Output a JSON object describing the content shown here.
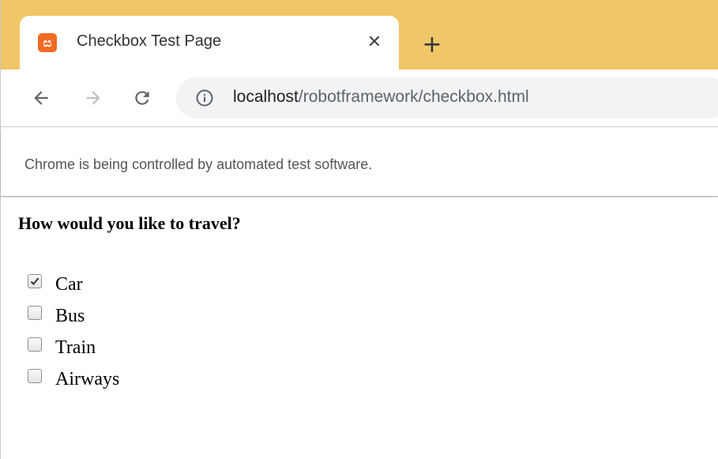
{
  "browser": {
    "tab": {
      "title": "Checkbox Test Page",
      "favicon_text": "ස",
      "close_glyph": "✕"
    },
    "new_tab_glyph": "+",
    "url": {
      "host": "localhost",
      "path": "/robotframework/checkbox.html"
    },
    "infobar_text": "Chrome is being controlled by automated test software.",
    "colors": {
      "tabstrip": "#f1c668",
      "favicon": "#f26a22"
    }
  },
  "page": {
    "question": "How would you like to travel?",
    "options": [
      {
        "label": "Car",
        "checked": true
      },
      {
        "label": "Bus",
        "checked": false
      },
      {
        "label": "Train",
        "checked": false
      },
      {
        "label": "Airways",
        "checked": false
      }
    ]
  },
  "icons": {
    "back": "arrow-left-icon",
    "forward": "arrow-right-icon",
    "reload": "reload-icon",
    "info": "info-icon",
    "check": "checkmark-icon"
  }
}
